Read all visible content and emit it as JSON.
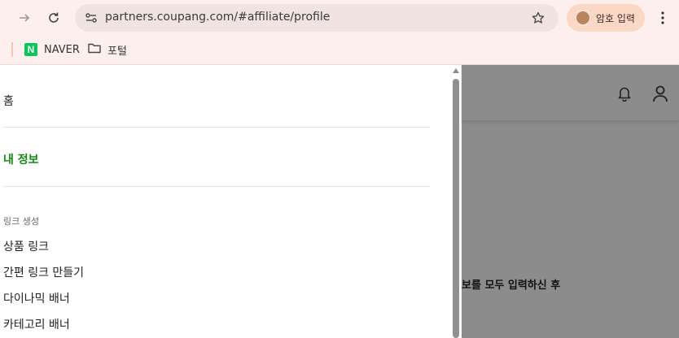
{
  "browser": {
    "url": "partners.coupang.com/#affiliate/profile",
    "profile_label": "암호 입력",
    "icons": [
      "forward-icon",
      "reload-icon",
      "site-info-icon",
      "bookmark-star-icon",
      "profile-avatar-icon",
      "menu-kebab-icon"
    ]
  },
  "bookmarks": [
    {
      "label": "NAVER",
      "icon": "naver-logo-icon"
    },
    {
      "label": "포털",
      "icon": "folder-icon"
    }
  ],
  "drawer": {
    "home": "홈",
    "my_info": "내 정보",
    "section_link": "링크 생성",
    "items": [
      "상품 링크",
      "간편 링크 만들기",
      "다이나믹 배너",
      "카테고리 배너"
    ]
  },
  "page": {
    "visible_text": "보를 모두 입력하신 후",
    "header_icons": [
      "bell-icon",
      "user-icon"
    ]
  },
  "colors": {
    "toolbar_bg": "#fdf0ec",
    "active_menu": "#148a14",
    "overlay": "#8c8c8c",
    "profile_chip": "#fbd7c6"
  }
}
